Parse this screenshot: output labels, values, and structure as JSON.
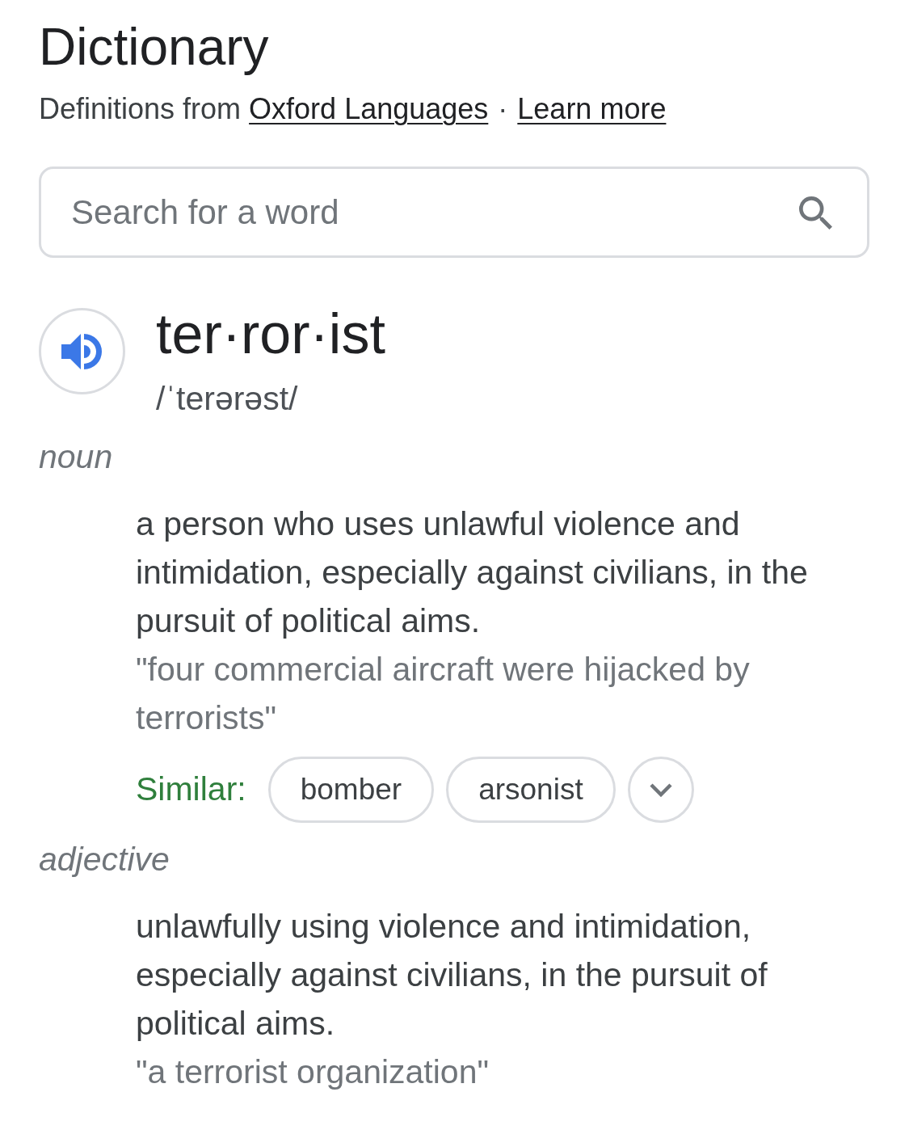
{
  "header": {
    "title": "Dictionary",
    "source": {
      "prefix": "Definitions from",
      "link": "Oxford Languages",
      "separator": "·",
      "learn_more": "Learn more"
    }
  },
  "search": {
    "placeholder": "Search for a word"
  },
  "entry": {
    "headword": "ter·ror·ist",
    "phonetic": "/ˈterərəst/"
  },
  "senses": [
    {
      "part_of_speech": "noun",
      "definitions": [
        {
          "text": "a person who uses unlawful violence and intimidation, especially against civilians, in the pursuit of political aims.",
          "example": "\"four commercial aircraft were hijacked by terrorists\"",
          "similar": {
            "label": "Similar:",
            "words": [
              "bomber",
              "arsonist"
            ],
            "expanded": false
          }
        }
      ]
    },
    {
      "part_of_speech": "adjective",
      "definitions": [
        {
          "text": "unlawfully using violence and intimidation, especially against civilians, in the pursuit of political aims.",
          "example": "\"a terrorist organization\""
        }
      ]
    }
  ]
}
